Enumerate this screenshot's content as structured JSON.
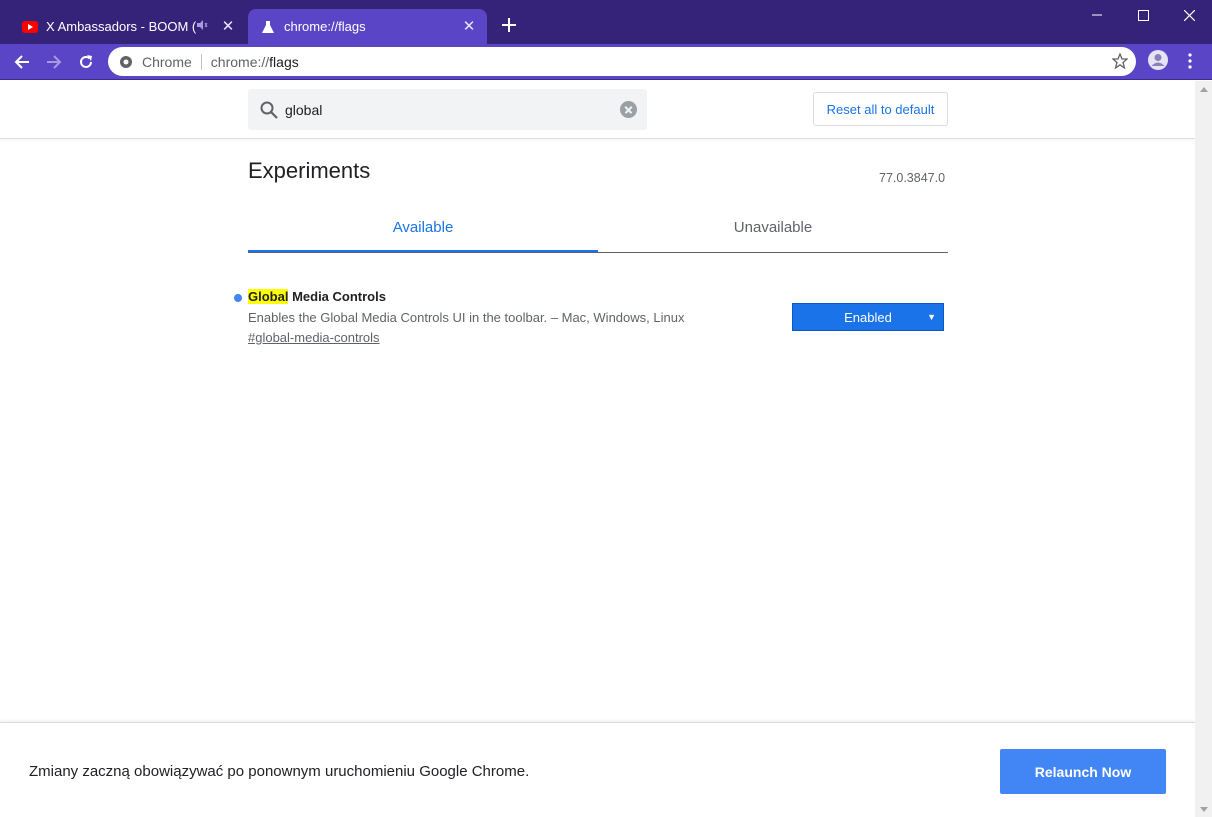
{
  "tabs": [
    {
      "title": "X Ambassadors - BOOM (Offi",
      "icon": "youtube-icon",
      "audio_icon": "speaker-muted-icon"
    },
    {
      "title": "chrome://flags",
      "icon": "flask-icon"
    }
  ],
  "window_controls": [
    "minimize",
    "maximize",
    "close"
  ],
  "toolbar": {
    "site_chip": "Chrome",
    "url_scheme": "chrome://",
    "url_host": "flags"
  },
  "search": {
    "query": "global"
  },
  "reset_button": "Reset all to default",
  "page_title": "Experiments",
  "version": "77.0.3847.0",
  "page_tabs": {
    "available": "Available",
    "unavailable": "Unavailable"
  },
  "experiment": {
    "name_highlight": "Global",
    "name_rest": " Media Controls",
    "description": "Enables the Global Media Controls UI in the toolbar. – Mac, Windows, Linux",
    "link": "#global-media-controls",
    "state": "Enabled"
  },
  "footer": {
    "message": "Zmiany zaczną obowiązywać po ponownym uruchomieniu Google Chrome.",
    "relaunch": "Relaunch Now"
  },
  "colors": {
    "titlebar": "#35237a",
    "toolbar": "#5b45c7",
    "accent": "#1a73e8",
    "relaunch": "#4285f4",
    "highlight": "#ffff00"
  }
}
